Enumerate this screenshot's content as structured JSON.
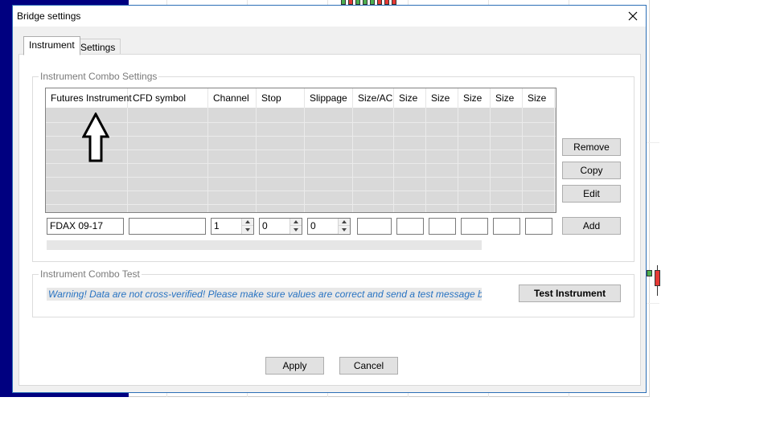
{
  "window": {
    "title": "Bridge settings"
  },
  "tabs": [
    {
      "label": "Instrument",
      "active": true
    },
    {
      "label": "Settings",
      "active": false
    }
  ],
  "combo_settings": {
    "group_title": "Instrument Combo Settings",
    "columns": [
      "Futures Instrument",
      "CFD symbol",
      "Channel",
      "Stop",
      "Slippage",
      "Size/AC",
      "Size",
      "Size",
      "Size",
      "Size",
      "Size"
    ],
    "rows": [],
    "side_buttons": {
      "remove": "Remove",
      "copy": "Copy",
      "edit": "Edit",
      "add": "Add"
    },
    "inputs": {
      "futures_instrument": "FDAX 09-17",
      "cfd_symbol": "",
      "channel": "1",
      "stop": "0",
      "slippage": "0",
      "size_ac": "",
      "size_1": "",
      "size_2": "",
      "size_3": "",
      "size_4": "",
      "size_5": ""
    }
  },
  "combo_test": {
    "group_title": "Instrument Combo Test",
    "warning": "Warning!  Data are not cross-verified!  Please make sure values are correct and send a test message before use!",
    "test_button": "Test Instrument"
  },
  "footer": {
    "apply": "Apply",
    "cancel": "Cancel"
  },
  "colors": {
    "accent_border": "#2c6fb6",
    "warning_text": "#2873c2",
    "background_navy": "#000080"
  },
  "icons": {
    "close": "close-icon",
    "annotation": "up-arrow-icon",
    "spin": "spin-arrow-icon"
  }
}
